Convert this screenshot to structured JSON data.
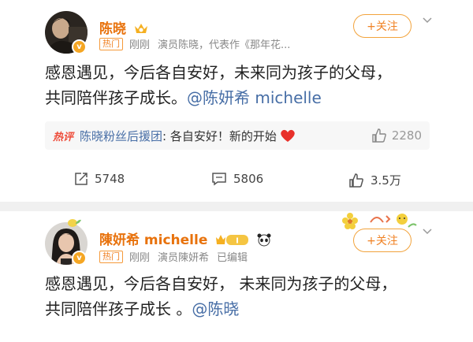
{
  "post1": {
    "author": "陈晓",
    "hot_tag": "热门",
    "time": "刚刚",
    "description": "演员陈晓，代表作《那年花...",
    "follow_label": "+关注",
    "content_line1": "感恩遇见，今后各自安好，未来同为孩子的父母，",
    "content_line2_prefix": "共同陪伴孩子成长。",
    "content_mention": "@陈妍希 michelle",
    "hot_comment": {
      "tag": "热评",
      "user": "陈晓粉丝后援团",
      "text": ": 各自安好！新的开始",
      "likes": "2280"
    },
    "actions": {
      "reposts": "5748",
      "comments": "5806",
      "likes": "3.5万"
    }
  },
  "post2": {
    "author": "陳妍希 michelle",
    "level_badge": "I",
    "hot_tag": "热门",
    "time": "刚刚",
    "description": "演员陳妍希",
    "edited": "已编辑",
    "follow_label": "+关注",
    "content_line1": "感恩遇见，今后各自安好， 未来同为孩子的父母，",
    "content_line2_prefix": "共同陪伴孩子成长 。",
    "content_mention": "@陈晓"
  },
  "colors": {
    "accent": "#f08224",
    "link": "#476ea6",
    "hot_red": "#ee4c3a"
  }
}
